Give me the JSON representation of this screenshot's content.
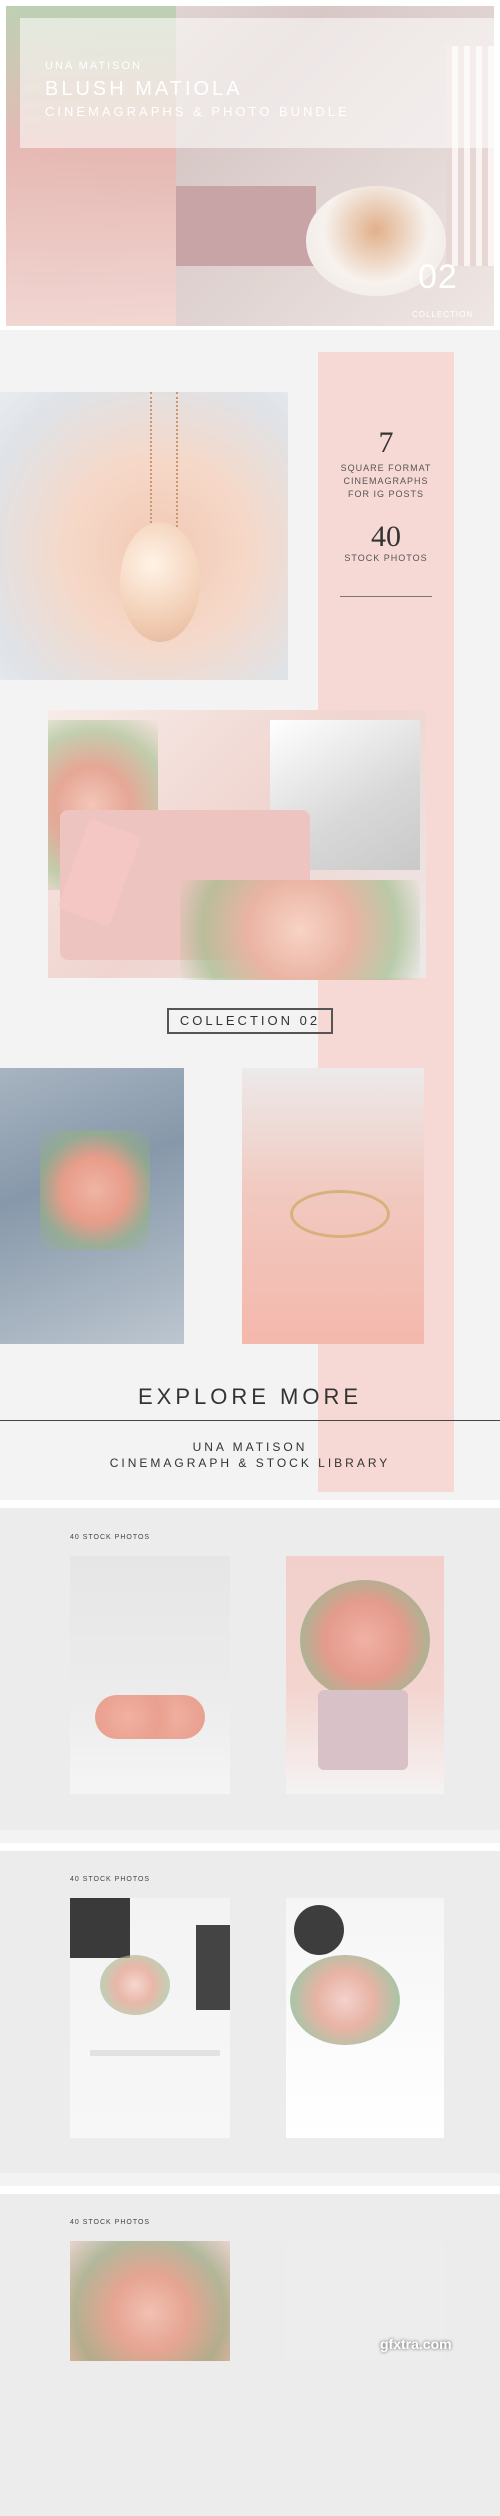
{
  "hero": {
    "brand": "UNA MATISON",
    "title": "BLUSH MATIOLA",
    "subtitle": "CINEMAGRAPHS & PHOTO BUNDLE",
    "number": "02",
    "collection_label": "COLLECTION"
  },
  "stats": {
    "cinemagraph_count": "7",
    "cinemagraph_text": [
      "SQUARE FORMAT",
      "CINEMAGRAPHS",
      "FOR IG POSTS"
    ],
    "photo_count": "40",
    "photo_text": "STOCK PHOTOS"
  },
  "collection_badge": "COLLECTION 02",
  "explore": {
    "heading": "EXPLORE MORE",
    "line1": "UNA MATISON",
    "line2": "CINEMAGRAPH & STOCK LIBRARY"
  },
  "panels": [
    {
      "label": "40 STOCK PHOTOS"
    },
    {
      "label": "40 STOCK PHOTOS"
    },
    {
      "label": "40 STOCK PHOTOS"
    }
  ],
  "colors": {
    "accent_pink": "#f6d9d5",
    "background": "#f3f3f3",
    "text": "#333333"
  },
  "watermark": "gfxtra.com"
}
